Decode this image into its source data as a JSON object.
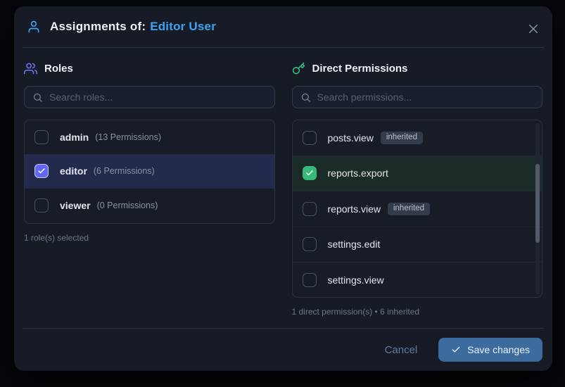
{
  "modal": {
    "title_prefix": "Assignments of:",
    "title_user": "Editor User"
  },
  "roles_panel": {
    "title": "Roles",
    "search_placeholder": "Search roles...",
    "items": [
      {
        "name": "admin",
        "detail": "(13 Permissions)",
        "checked": false,
        "selected": false
      },
      {
        "name": "editor",
        "detail": "(6 Permissions)",
        "checked": true,
        "selected": true
      },
      {
        "name": "viewer",
        "detail": "(0 Permissions)",
        "checked": false,
        "selected": false
      }
    ],
    "summary": "1 role(s) selected"
  },
  "permissions_panel": {
    "title": "Direct Permissions",
    "search_placeholder": "Search permissions...",
    "items": [
      {
        "name": "posts.view",
        "badge": "inherited",
        "checked": false,
        "selected": false
      },
      {
        "name": "reports.export",
        "badge": null,
        "checked": true,
        "selected": true
      },
      {
        "name": "reports.view",
        "badge": "inherited",
        "checked": false,
        "selected": false
      },
      {
        "name": "settings.edit",
        "badge": null,
        "checked": false,
        "selected": false
      },
      {
        "name": "settings.view",
        "badge": null,
        "checked": false,
        "selected": false
      }
    ],
    "summary": "1 direct permission(s) • 6 inherited"
  },
  "footer": {
    "cancel_label": "Cancel",
    "save_label": "Save changes"
  },
  "colors": {
    "accent_blue": "#3ba4f2",
    "accent_indigo": "#6366f0",
    "accent_green": "#37b97c",
    "save_button": "#3c6b9e",
    "modal_bg": "#161b26",
    "page_bg": "#05060a"
  }
}
